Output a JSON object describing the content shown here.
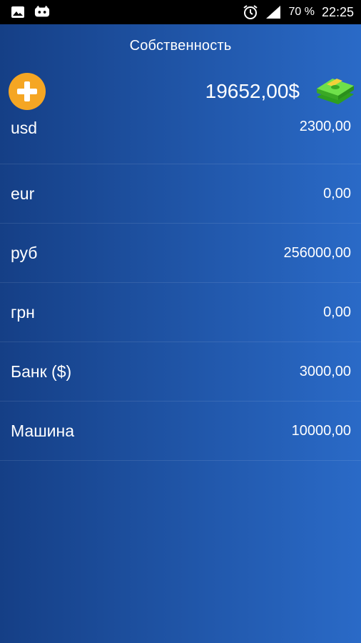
{
  "status_bar": {
    "battery": "70 %",
    "time": "22:25"
  },
  "header": {
    "title": "Собственность"
  },
  "summary": {
    "total": "19652,00$",
    "add_icon": "plus-icon",
    "money_icon": "money-stack-icon"
  },
  "assets": [
    {
      "label": "usd",
      "value": "2300,00"
    },
    {
      "label": "eur",
      "value": "0,00"
    },
    {
      "label": "руб",
      "value": "256000,00"
    },
    {
      "label": "грн",
      "value": "0,00"
    },
    {
      "label": "Банк ($)",
      "value": "3000,00"
    },
    {
      "label": "Машина",
      "value": "10000,00"
    }
  ],
  "colors": {
    "background_start": "#153f86",
    "background_end": "#2a6ac7",
    "accent": "#f5a623",
    "money_green": "#5fd13a"
  }
}
